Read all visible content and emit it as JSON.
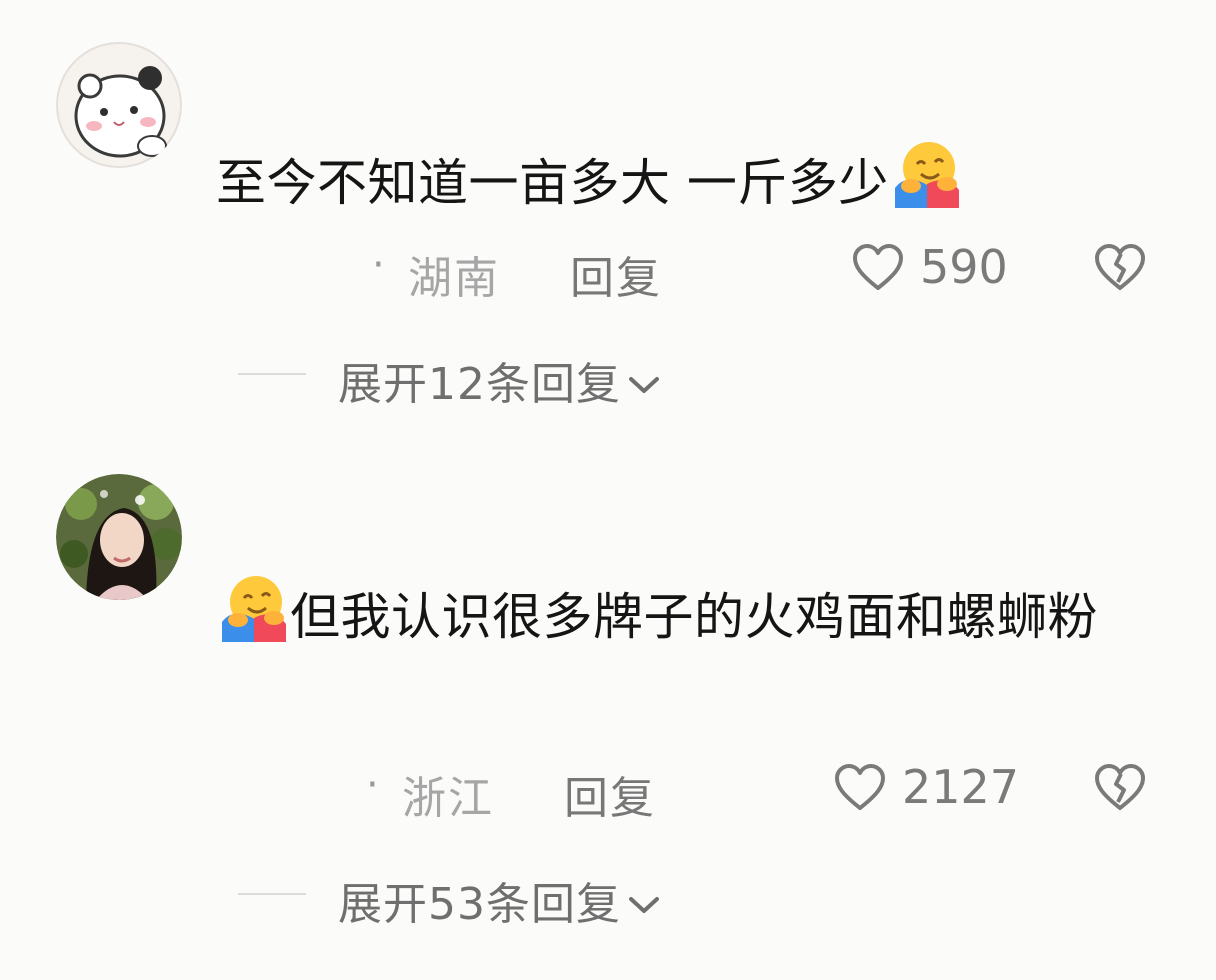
{
  "comments": [
    {
      "avatar": "panda-cartoon-avatar",
      "text": "至今不知道一亩多大 一斤多少",
      "emoji": "hugging-face-emoji",
      "location": "湖南",
      "dot": "·",
      "reply_label": "回复",
      "likes": "590",
      "expand_label": "展开12条回复"
    },
    {
      "avatar": "girl-photo-avatar",
      "text": "但我认识很多牌子的火鸡面和螺蛳粉",
      "emoji": "hugging-face-emoji",
      "location": "浙江",
      "dot": "·",
      "reply_label": "回复",
      "likes": "2127",
      "expand_label": "展开53条回复"
    }
  ],
  "icons": {
    "like": "heart-outline-icon",
    "dislike": "broken-heart-icon",
    "expand": "chevron-down-icon"
  },
  "colors": {
    "background": "#fbfbf9",
    "text": "#151515",
    "meta": "#a6a6a6"
  }
}
